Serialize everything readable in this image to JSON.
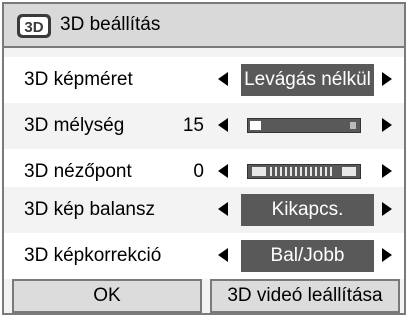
{
  "dialog": {
    "title": "3D beállítás",
    "icon": "3d-icon"
  },
  "rows": [
    {
      "label": "3D képméret",
      "value": "Levágás nélkül"
    },
    {
      "label": "3D mélység",
      "number": "15",
      "level": 0.1
    },
    {
      "label": "3D nézőpont",
      "number": "0"
    },
    {
      "label": "3D kép balansz",
      "value": "Kikapcs."
    },
    {
      "label": "3D képkorrekció",
      "value": "Bal/Jobb"
    }
  ],
  "buttons": {
    "ok": "OK",
    "stop": "3D videó leállítása"
  },
  "colors": {
    "value_bg": "#595959",
    "title_bg": "#d9d9d9",
    "border": "#7a7a7a"
  }
}
